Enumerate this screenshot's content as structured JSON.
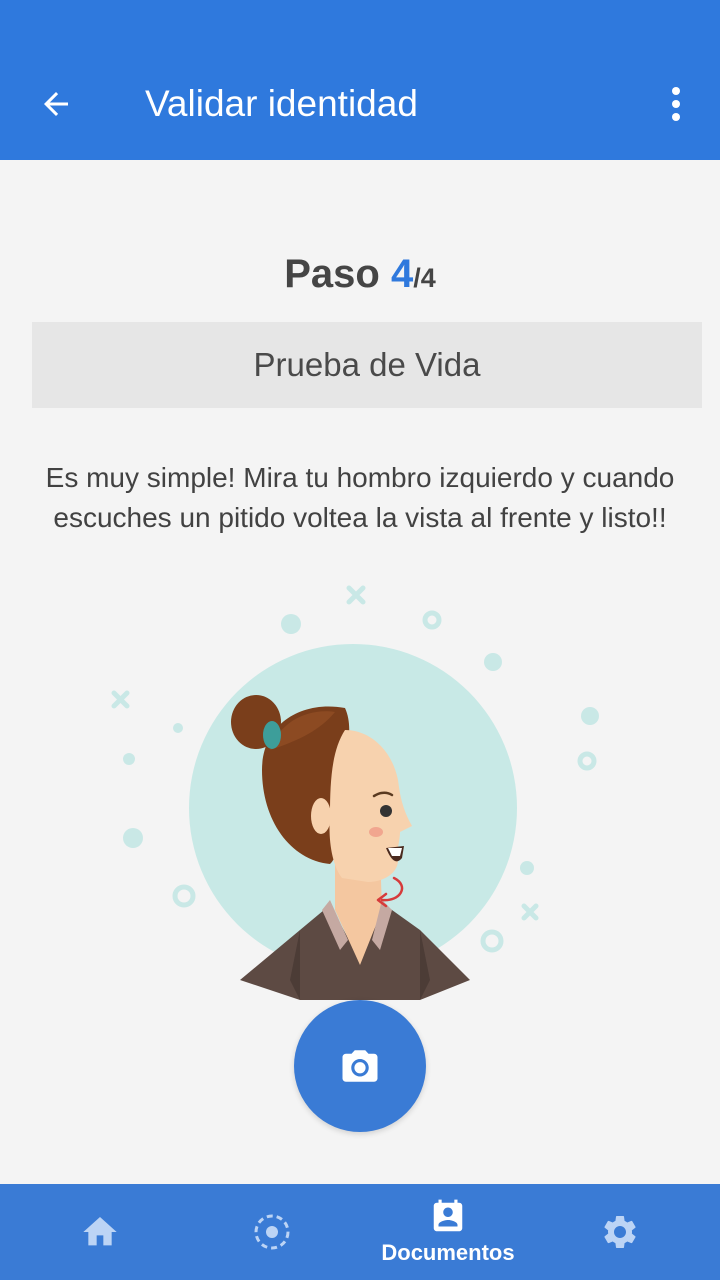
{
  "appbar": {
    "title": "Validar identidad",
    "back_icon": "arrow-back-icon",
    "menu_icon": "more-vert-icon",
    "color": "#2f79dd"
  },
  "step": {
    "label": "Paso",
    "current": "4",
    "total": "/4"
  },
  "section": {
    "title": "Prueba de Vida"
  },
  "instructions": {
    "text": "Es muy simple! Mira tu hombro izquierdo y cuando escuches un pitido voltea la vista al frente y listo!!"
  },
  "camera_button": {
    "icon": "camera-icon",
    "color": "#3a7bd5"
  },
  "bottom_nav": {
    "items": [
      {
        "icon": "home-icon",
        "label": ""
      },
      {
        "icon": "face-scan-icon",
        "label": ""
      },
      {
        "icon": "documents-icon",
        "label": "Documentos",
        "active": true
      },
      {
        "icon": "gear-icon",
        "label": ""
      }
    ]
  }
}
